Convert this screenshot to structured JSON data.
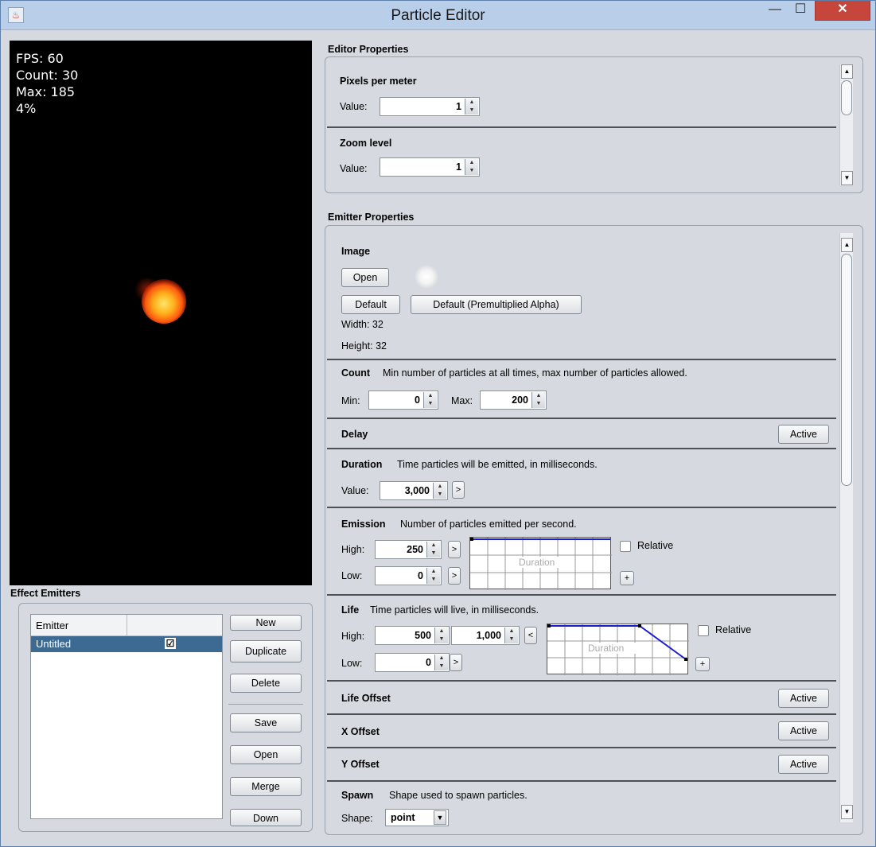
{
  "window": {
    "title": "Particle Editor",
    "min_label": "—",
    "max_label": "☐",
    "close_label": "✕"
  },
  "stats": {
    "fps": "FPS: 60",
    "count": "Count: 30",
    "max": "Max: 185",
    "percent": "4%"
  },
  "effect_emitters": {
    "title": "Effect Emitters",
    "columns": [
      "Emitter",
      ""
    ],
    "rows": [
      {
        "name": "Untitled",
        "checked": "☑"
      }
    ],
    "buttons": {
      "new": "New",
      "duplicate": "Duplicate",
      "delete": "Delete",
      "save": "Save",
      "open": "Open",
      "merge": "Merge",
      "down": "Down"
    }
  },
  "editor_properties": {
    "title": "Editor Properties",
    "pixels_per_meter": {
      "label": "Pixels per meter",
      "value_label": "Value:",
      "value": "1"
    },
    "zoom_level": {
      "label": "Zoom level",
      "value_label": "Value:",
      "value": "1"
    }
  },
  "emitter_properties": {
    "title": "Emitter Properties",
    "image": {
      "label": "Image",
      "open": "Open",
      "default": "Default",
      "default_pma": "Default (Premultiplied Alpha)",
      "width": "Width: 32",
      "height": "Height: 32"
    },
    "count": {
      "label": "Count",
      "desc": "Min number of particles at all times, max number of particles allowed.",
      "min_label": "Min:",
      "min": "0",
      "max_label": "Max:",
      "max": "200"
    },
    "delay": {
      "label": "Delay",
      "active": "Active"
    },
    "duration": {
      "label": "Duration",
      "desc": "Time particles will be emitted, in milliseconds.",
      "value_label": "Value:",
      "value": "3,000",
      "expand": ">"
    },
    "emission": {
      "label": "Emission",
      "desc": "Number of particles emitted per second.",
      "high_label": "High:",
      "high": "250",
      "low_label": "Low:",
      "low": "0",
      "expand": ">",
      "relative": "Relative",
      "chart_label": "Duration",
      "plus": "+"
    },
    "life": {
      "label": "Life",
      "desc": "Time particles will live, in milliseconds.",
      "high_label": "High:",
      "high": "500",
      "high2": "1,000",
      "collapse": "<",
      "low_label": "Low:",
      "low": "0",
      "expand": ">",
      "relative": "Relative",
      "chart_label": "Duration",
      "plus": "+"
    },
    "life_offset": {
      "label": "Life Offset",
      "active": "Active"
    },
    "x_offset": {
      "label": "X Offset",
      "active": "Active"
    },
    "y_offset": {
      "label": "Y Offset",
      "active": "Active"
    },
    "spawn": {
      "label": "Spawn",
      "desc": "Shape used to spawn particles.",
      "shape_label": "Shape:",
      "shape": "point"
    }
  },
  "icons": {
    "app": "java-icon",
    "dropdown": "chevron-down-icon"
  }
}
